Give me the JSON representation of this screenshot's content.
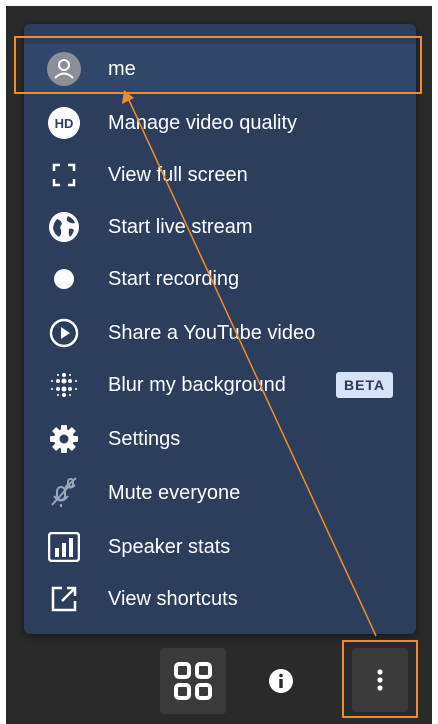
{
  "menu": {
    "items": [
      {
        "label": "me",
        "icon": "avatar-icon"
      },
      {
        "label": "Manage video quality",
        "icon": "hd-icon",
        "icon_text": "HD"
      },
      {
        "label": "View full screen",
        "icon": "fullscreen-icon"
      },
      {
        "label": "Start live stream",
        "icon": "globe-icon"
      },
      {
        "label": "Start recording",
        "icon": "record-icon"
      },
      {
        "label": "Share a YouTube video",
        "icon": "play-circle-icon"
      },
      {
        "label": "Blur my background",
        "icon": "blur-icon",
        "badge": "BETA"
      },
      {
        "label": "Settings",
        "icon": "gear-icon"
      },
      {
        "label": "Mute everyone",
        "icon": "mic-muted-icon"
      },
      {
        "label": "Speaker stats",
        "icon": "bar-chart-icon"
      },
      {
        "label": "View shortcuts",
        "icon": "external-link-icon"
      }
    ]
  },
  "toolbar": {
    "buttons": [
      {
        "name": "tile-view",
        "icon": "grid-icon"
      },
      {
        "name": "info",
        "icon": "info-icon"
      },
      {
        "name": "more-actions",
        "icon": "more-vertical-icon"
      }
    ]
  },
  "colors": {
    "menu_bg": "#2c3e5c",
    "highlight": "#f28c28",
    "toolbar_bg": "#2a2a2a"
  }
}
